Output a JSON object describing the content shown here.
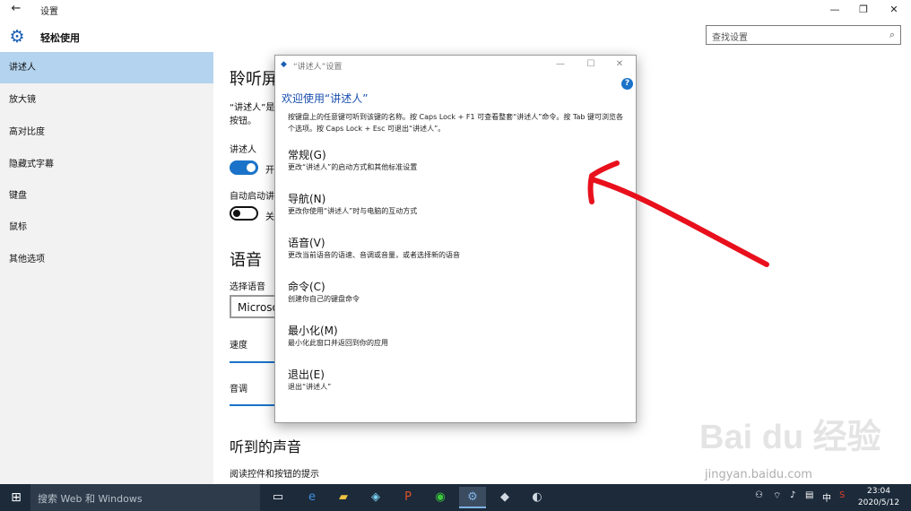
{
  "window": {
    "title": "设置",
    "back_icon": "back-arrow-icon",
    "min_label": "—",
    "max_label": "❐",
    "close_label": "✕"
  },
  "header": {
    "title": "轻松使用",
    "icon": "gear-icon",
    "search_placeholder": "查找设置"
  },
  "sidebar": {
    "items": [
      {
        "label": "讲述人",
        "active": true
      },
      {
        "label": "放大镜",
        "active": false
      },
      {
        "label": "高对比度",
        "active": false
      },
      {
        "label": "隐藏式字幕",
        "active": false
      },
      {
        "label": "键盘",
        "active": false
      },
      {
        "label": "鼠标",
        "active": false
      },
      {
        "label": "其他选项",
        "active": false
      }
    ]
  },
  "main": {
    "section_heading": "聆听屏",
    "desc_line1": "“讲述人”是",
    "desc_line2": "按钮。",
    "narrator_label": "讲述人",
    "narrator_toggle_text": "开",
    "narrator_on": true,
    "autostart_label": "自动启动讲",
    "autostart_toggle_text": "关",
    "autostart_on": false,
    "voice_heading": "语音",
    "select_voice_label": "选择语音",
    "voice_value": "Microso",
    "speed_label": "速度",
    "pitch_label": "音调",
    "sounds_heading": "听到的声音",
    "read_controls_label": "阅读控件和按钮的提示"
  },
  "dialog": {
    "title": "“讲述人”设置",
    "help_label": "?",
    "welcome": "欢迎使用“讲述人”",
    "intro": "按键盘上的任意键可听到该键的名称。按 Caps Lock + F1 可查看整套“讲述人”命令。按 Tab 键可浏览各个选项。按 Caps Lock + Esc 可退出“讲述人”。",
    "options": [
      {
        "title": "常规(G)",
        "desc": "更改“讲述人”的启动方式和其他标准设置"
      },
      {
        "title": "导航(N)",
        "desc": "更改你使用“讲述人”时与电脑的互动方式"
      },
      {
        "title": "语音(V)",
        "desc": "更改当前语音的语速、音调或音量，或者选择新的语音"
      },
      {
        "title": "命令(C)",
        "desc": "创建你自己的键盘命令"
      },
      {
        "title": "最小化(M)",
        "desc": "最小化此窗口并返回到你的应用"
      },
      {
        "title": "退出(E)",
        "desc": "退出“讲述人”"
      }
    ]
  },
  "annotation": {
    "color": "#e8101c"
  },
  "watermark": {
    "logo": "Baidu经验",
    "url": "jingyan.baidu.com"
  },
  "taskbar": {
    "search_placeholder": "搜索 Web 和 Windows",
    "time": "23:04",
    "date": "2020/5/12",
    "ime": "中"
  }
}
